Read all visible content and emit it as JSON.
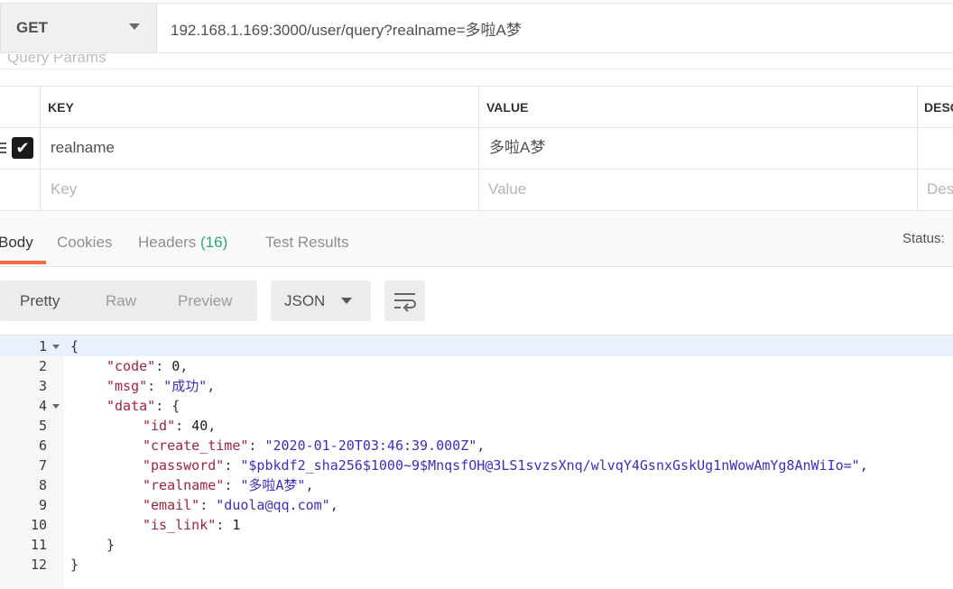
{
  "request": {
    "method": "GET",
    "url": "192.168.1.169:3000/user/query?realname=多啦A梦",
    "query_params_label": "Query Params"
  },
  "params_table": {
    "headers": {
      "key": "KEY",
      "value": "VALUE",
      "description": "DESC"
    },
    "rows": [
      {
        "key": "realname",
        "value": "多啦A梦",
        "checked": true
      }
    ],
    "placeholders": {
      "key": "Key",
      "value": "Value",
      "description": "Des"
    }
  },
  "response_tabs": {
    "body": "Body",
    "cookies": "Cookies",
    "headers": "Headers",
    "headers_count": "(16)",
    "test_results": "Test Results",
    "status_label": "Status:"
  },
  "body_toolbar": {
    "pretty": "Pretty",
    "raw": "Raw",
    "preview": "Preview",
    "format": "JSON"
  },
  "response_lines": [
    {
      "num": "1",
      "fold": true,
      "indent": 0,
      "parts": [
        [
          "p",
          "{"
        ]
      ]
    },
    {
      "num": "2",
      "fold": false,
      "indent": 1,
      "parts": [
        [
          "k",
          "\"code\""
        ],
        [
          "p",
          ": "
        ],
        [
          "n",
          "0"
        ],
        [
          "p",
          ","
        ]
      ]
    },
    {
      "num": "3",
      "fold": false,
      "indent": 1,
      "parts": [
        [
          "k",
          "\"msg\""
        ],
        [
          "p",
          ": "
        ],
        [
          "s",
          "\"成功\""
        ],
        [
          "p",
          ","
        ]
      ]
    },
    {
      "num": "4",
      "fold": true,
      "indent": 1,
      "parts": [
        [
          "k",
          "\"data\""
        ],
        [
          "p",
          ": {"
        ]
      ]
    },
    {
      "num": "5",
      "fold": false,
      "indent": 2,
      "parts": [
        [
          "k",
          "\"id\""
        ],
        [
          "p",
          ": "
        ],
        [
          "n",
          "40"
        ],
        [
          "p",
          ","
        ]
      ]
    },
    {
      "num": "6",
      "fold": false,
      "indent": 2,
      "parts": [
        [
          "k",
          "\"create_time\""
        ],
        [
          "p",
          ": "
        ],
        [
          "s",
          "\"2020-01-20T03:46:39.000Z\""
        ],
        [
          "p",
          ","
        ]
      ]
    },
    {
      "num": "7",
      "fold": false,
      "indent": 2,
      "parts": [
        [
          "k",
          "\"password\""
        ],
        [
          "p",
          ": "
        ],
        [
          "s",
          "\"$pbkdf2_sha256$1000~9$MnqsfOH@3LS1svzsXnq/wlvqY4GsnxGskUg1nWowAmYg8AnWiIo=\""
        ],
        [
          "p",
          ","
        ]
      ]
    },
    {
      "num": "8",
      "fold": false,
      "indent": 2,
      "parts": [
        [
          "k",
          "\"realname\""
        ],
        [
          "p",
          ": "
        ],
        [
          "s",
          "\"多啦A梦\""
        ],
        [
          "p",
          ","
        ]
      ]
    },
    {
      "num": "9",
      "fold": false,
      "indent": 2,
      "parts": [
        [
          "k",
          "\"email\""
        ],
        [
          "p",
          ": "
        ],
        [
          "s",
          "\"duola@qq.com\""
        ],
        [
          "p",
          ","
        ]
      ]
    },
    {
      "num": "10",
      "fold": false,
      "indent": 2,
      "parts": [
        [
          "k",
          "\"is_link\""
        ],
        [
          "p",
          ": "
        ],
        [
          "n",
          "1"
        ]
      ]
    },
    {
      "num": "11",
      "fold": false,
      "indent": 1,
      "parts": [
        [
          "p",
          "}"
        ]
      ]
    },
    {
      "num": "12",
      "fold": false,
      "indent": 0,
      "parts": [
        [
          "p",
          "}"
        ]
      ]
    }
  ],
  "colors": {
    "accent_tab_underline": "#f26b3a",
    "headers_count": "#26a96c",
    "json_key": "#a4233e",
    "json_string": "#3b2fbe"
  }
}
